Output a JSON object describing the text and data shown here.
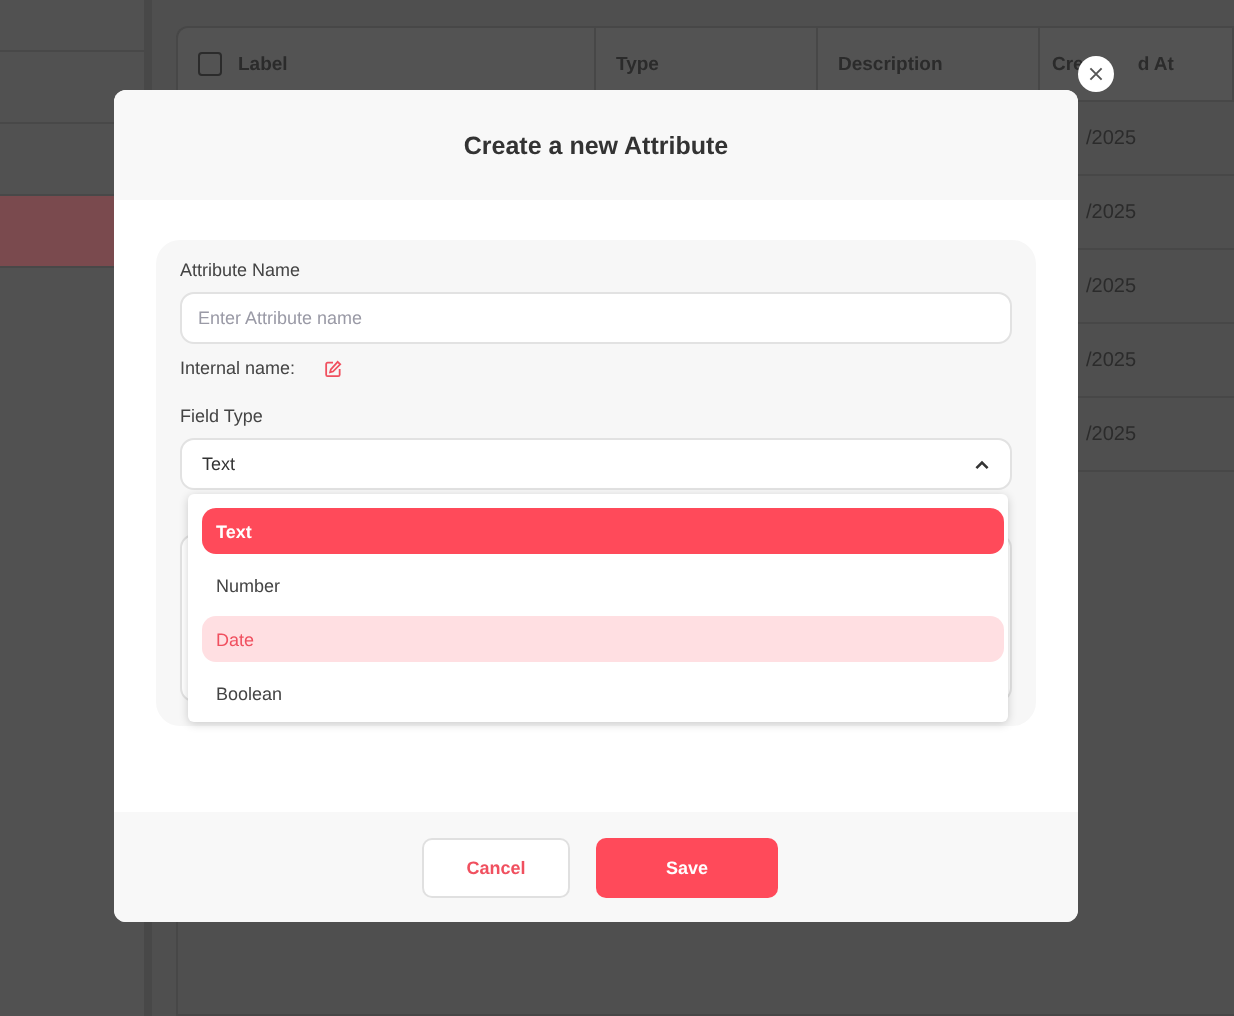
{
  "sidebar": {
    "items": [
      {
        "selected": false
      },
      {
        "selected": false
      },
      {
        "selected": true
      },
      {
        "selected": false
      }
    ]
  },
  "table": {
    "header_checkbox": {
      "checked": false
    },
    "columns": [
      {
        "fragments": [
          "Label"
        ]
      },
      {
        "fragments": [
          "Type"
        ]
      },
      {
        "fragments": [
          "Description"
        ]
      },
      {
        "fragments": [
          "Cre",
          "d At"
        ]
      }
    ],
    "rows": [
      {
        "created_at": "/2025"
      },
      {
        "created_at": "/2025"
      },
      {
        "created_at": "/2025"
      },
      {
        "created_at": "/2025"
      },
      {
        "created_at": "/2025"
      }
    ]
  },
  "modal": {
    "title": "Create a new Attribute",
    "attribute_name": {
      "label": "Attribute Name",
      "placeholder": "Enter Attribute name"
    },
    "internal_name": {
      "label": "Internal name:"
    },
    "field_type": {
      "label": "Field Type",
      "value": "Text",
      "expanded": true,
      "options": [
        {
          "label": "Text",
          "selected": true,
          "hovered": false
        },
        {
          "label": "Number",
          "selected": false,
          "hovered": false
        },
        {
          "label": "Date",
          "selected": false,
          "hovered": true
        },
        {
          "label": "Boolean",
          "selected": false,
          "hovered": false
        }
      ]
    },
    "buttons": [
      {
        "kind": "secondary",
        "label": "Cancel"
      },
      {
        "kind": "primary",
        "label": "Save"
      }
    ]
  }
}
